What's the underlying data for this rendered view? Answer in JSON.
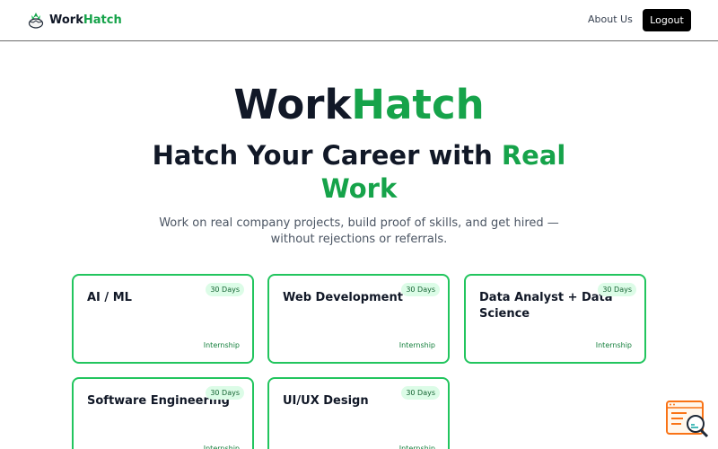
{
  "nav": {
    "brand_part1": "Work",
    "brand_part2": "Hatch",
    "about_label": "About Us",
    "logout_label": "Logout"
  },
  "hero": {
    "title_part1": "Work",
    "title_part2": "Hatch",
    "subtitle_part1": "Hatch Your Career with ",
    "subtitle_part2": "Real Work",
    "description": "Work on real company projects, build proof of skills, and get hired — without rejections or referrals."
  },
  "cards": [
    {
      "title": "AI / ML",
      "badge": "30 Days",
      "type": "Internship"
    },
    {
      "title": "Web Development",
      "badge": "30 Days",
      "type": "Internship"
    },
    {
      "title": "Data Analyst + Data Science",
      "badge": "30 Days",
      "type": "Internship"
    },
    {
      "title": "Software Engineering",
      "badge": "30 Days",
      "type": "Internship"
    },
    {
      "title": "UI/UX Design",
      "badge": "30 Days",
      "type": "Internship"
    }
  ],
  "colors": {
    "accent": "#16a34a",
    "card_border": "#22c55e",
    "badge_bg": "#dcfce7",
    "widget": "#f97316"
  },
  "icons": {
    "brand": "egg-plant-logo-icon",
    "widget": "chat-support-icon"
  }
}
